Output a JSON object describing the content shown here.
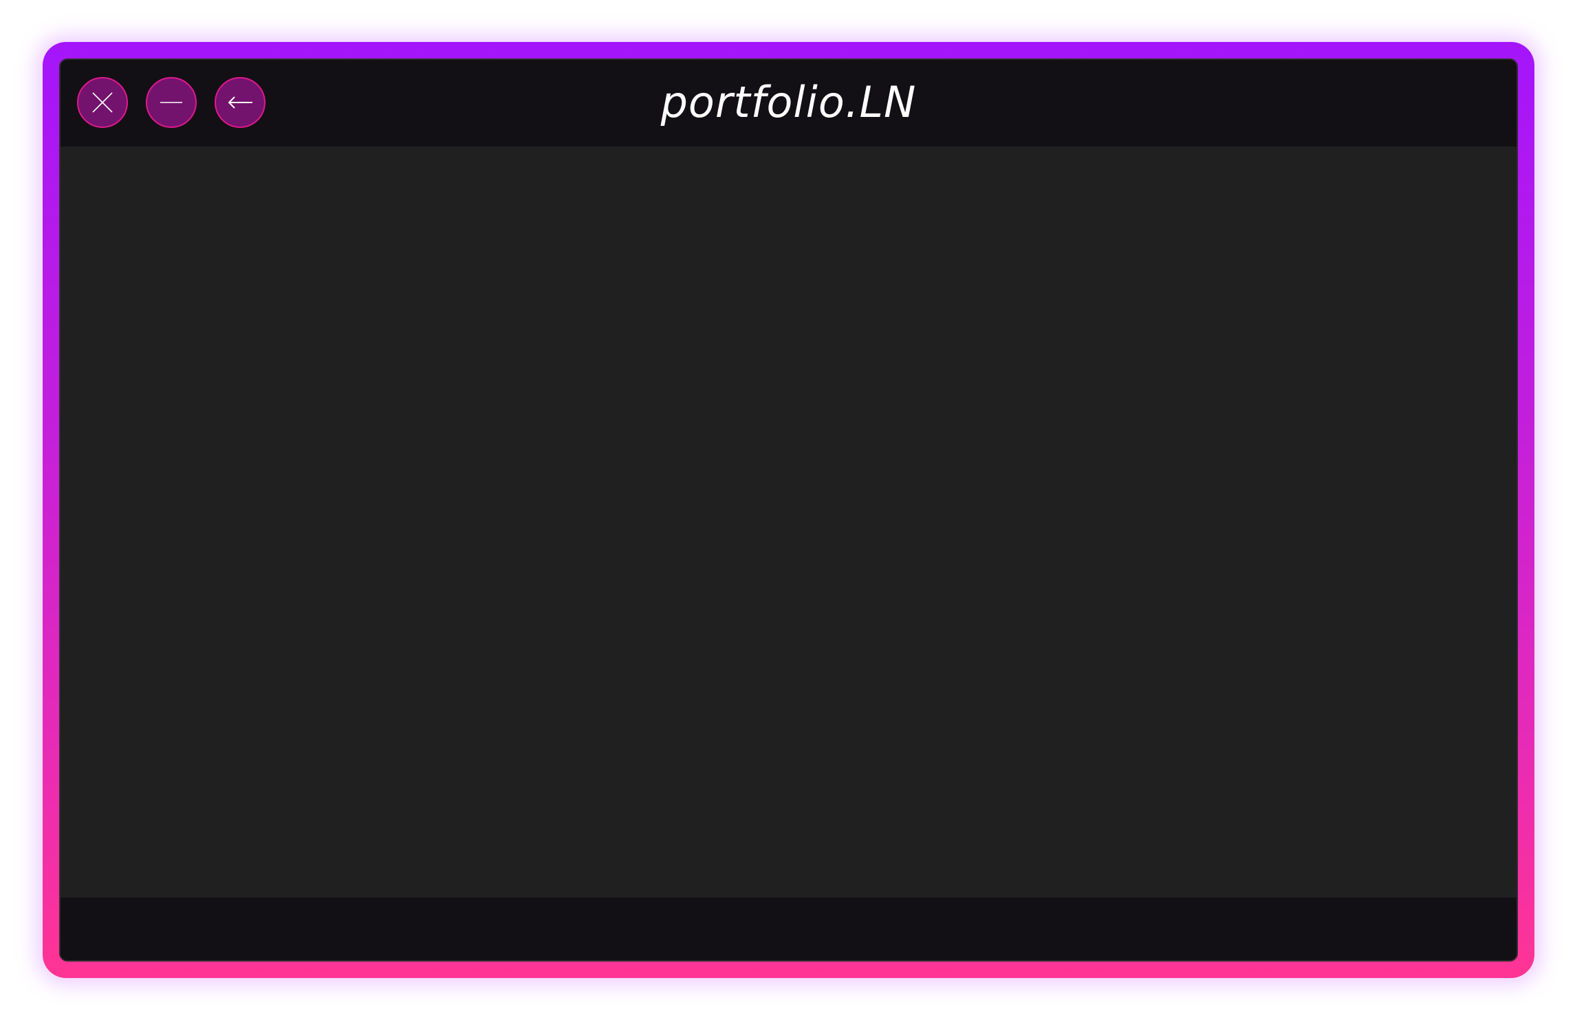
{
  "window": {
    "title": "portfolio.LN"
  },
  "controls": {
    "close": {
      "icon": "close-icon"
    },
    "minimize": {
      "icon": "minimize-icon"
    },
    "back": {
      "icon": "arrow-left-icon"
    }
  },
  "colors": {
    "frame_gradient_top": "#a415fb",
    "frame_gradient_bottom": "#ff3494",
    "titlebar_bg": "#121014",
    "content_bg": "#202020",
    "button_fill": "#74136d",
    "button_border": "#e0188f",
    "title_text": "#ffffff"
  }
}
